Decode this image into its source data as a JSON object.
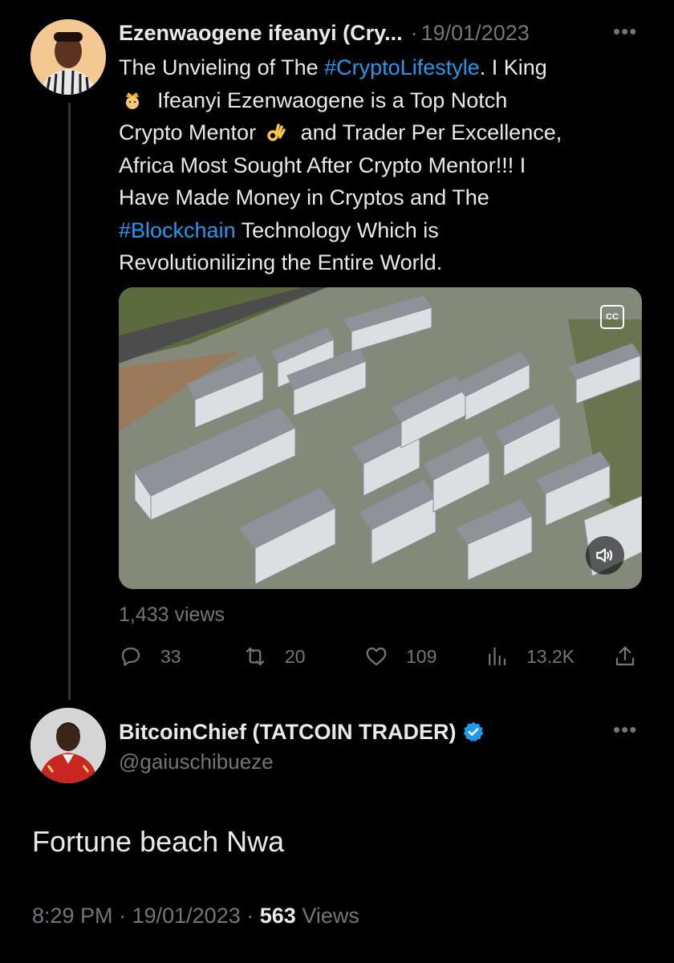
{
  "tweet": {
    "author_name": "Ezenwaogene ifeanyi (Cry...",
    "separator": "·",
    "date": "19/01/2023",
    "text_lines": [
      [
        "The Unvieling of The ",
        "#CryptoLifestyle",
        ". I King"
      ],
      [
        "Ifeanyi Ezenwaogene  is a Top Notch"
      ],
      [
        "Crypto Mentor ",
        "and Trader Per Excellence,"
      ],
      [
        "Africa Most Sought After Crypto Mentor!!! I"
      ],
      [
        "Have Made Money in Cryptos and The"
      ],
      [
        "#Blockchain",
        " Technology Which is"
      ],
      [
        "Revolutionilizing the Entire World."
      ]
    ],
    "media": {
      "cc_label": "CC"
    },
    "views_label": "1,433 views",
    "actions": {
      "replies": "33",
      "retweets": "20",
      "likes": "109",
      "views": "13.2K"
    }
  },
  "reply": {
    "author_name": "BitcoinChief (TATCOIN TRADER)",
    "handle": "@gaiuschibueze",
    "text": "Fortune beach Nwa",
    "meta": {
      "time": "8:29 PM",
      "separator": "·",
      "date": "19/01/2023",
      "separator2": "·",
      "views_count": "563",
      "views_label": "Views"
    }
  },
  "colors": {
    "hashtag": "#1d9bf0",
    "muted": "#71767b",
    "text": "#e7e9ea",
    "verified": "#1d9bf0"
  }
}
